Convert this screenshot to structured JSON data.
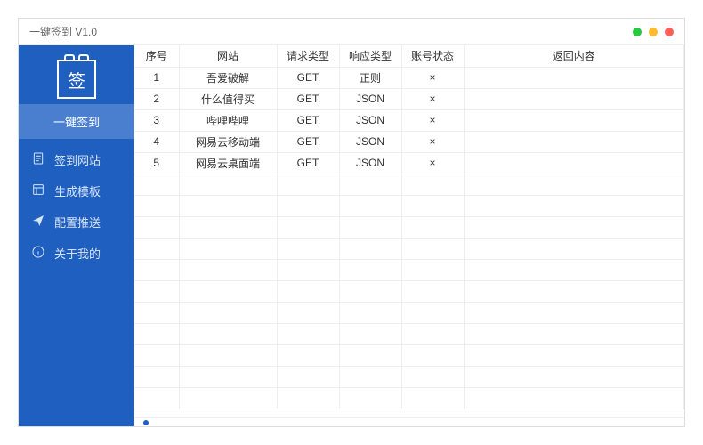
{
  "window": {
    "title": "一键签到 V1.0"
  },
  "sidebar": {
    "logo_char": "签",
    "items": [
      {
        "label": "一键签到",
        "active": true
      },
      {
        "label": "签到网站",
        "icon": "document-icon"
      },
      {
        "label": "生成模板",
        "icon": "template-icon"
      },
      {
        "label": "配置推送",
        "icon": "send-icon"
      },
      {
        "label": "关于我的",
        "icon": "info-icon"
      }
    ]
  },
  "table": {
    "headers": {
      "seq": "序号",
      "site": "网站",
      "request_type": "请求类型",
      "response_type": "响应类型",
      "account_status": "账号状态",
      "return_content": "返回内容"
    },
    "rows": [
      {
        "seq": "1",
        "site": "吾爱破解",
        "req": "GET",
        "resp": "正则",
        "acct": "×",
        "ret": ""
      },
      {
        "seq": "2",
        "site": "什么值得买",
        "req": "GET",
        "resp": "JSON",
        "acct": "×",
        "ret": ""
      },
      {
        "seq": "3",
        "site": "哔哩哔哩",
        "req": "GET",
        "resp": "JSON",
        "acct": "×",
        "ret": ""
      },
      {
        "seq": "4",
        "site": "网易云移动端",
        "req": "GET",
        "resp": "JSON",
        "acct": "×",
        "ret": ""
      },
      {
        "seq": "5",
        "site": "网易云桌面端",
        "req": "GET",
        "resp": "JSON",
        "acct": "×",
        "ret": ""
      }
    ],
    "empty_rows": 11
  }
}
